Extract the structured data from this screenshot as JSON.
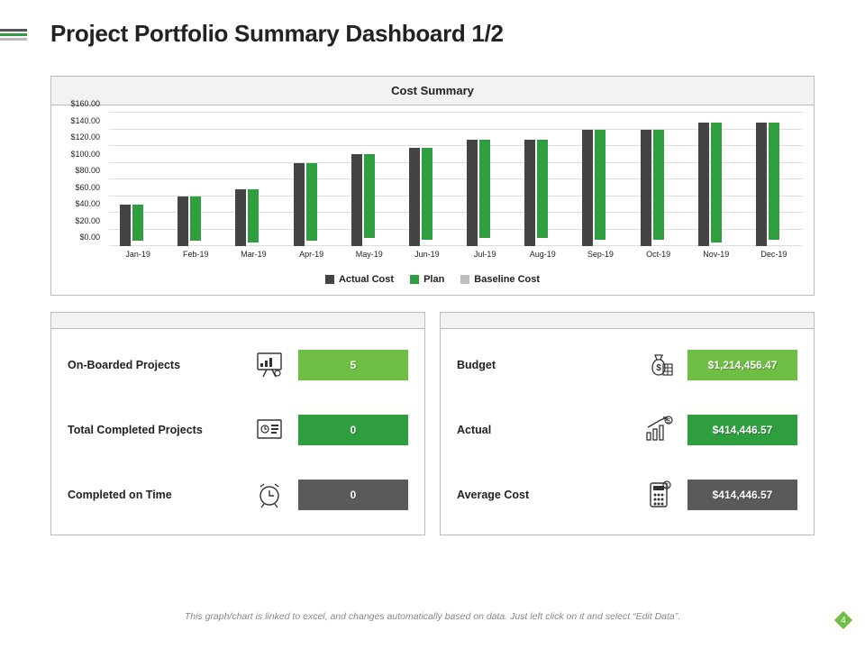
{
  "title": "Project Portfolio Summary Dashboard 1/2",
  "chart_data": {
    "type": "bar",
    "title": "Cost Summary",
    "categories": [
      "Jan-19",
      "Feb-19",
      "Mar-19",
      "Apr-19",
      "May-19",
      "Jun-19",
      "Jul-19",
      "Aug-19",
      "Sep-19",
      "Oct-19",
      "Nov-19",
      "Dec-19"
    ],
    "series": [
      {
        "name": "Actual Cost",
        "color": "#444444",
        "values": [
          50,
          60,
          68,
          100,
          110,
          118,
          128,
          128,
          140,
          140,
          148,
          148
        ]
      },
      {
        "name": "Plan",
        "color": "#2e9e3f",
        "values": [
          44,
          54,
          64,
          94,
          100,
          110,
          118,
          118,
          132,
          132,
          144,
          140
        ]
      },
      {
        "name": "Baseline Cost",
        "color": "#bdbdbd",
        "values": [
          null,
          null,
          null,
          null,
          null,
          null,
          null,
          null,
          null,
          null,
          null,
          null
        ]
      }
    ],
    "ylabel": "",
    "xlabel": "",
    "ylim": [
      0,
      160
    ],
    "y_ticks": [
      "$0.00",
      "$20.00",
      "$40.00",
      "$60.00",
      "$80.00",
      "$100.00",
      "$120.00",
      "$140.00",
      "$160.00"
    ]
  },
  "metrics_left": [
    {
      "label": "On-Boarded Projects",
      "value": "5",
      "pill": "pill-bright",
      "icon": "presentation"
    },
    {
      "label": "Total Completed Projects",
      "value": "0",
      "pill": "pill-green",
      "icon": "board-clock"
    },
    {
      "label": "Completed on Time",
      "value": "0",
      "pill": "pill-gray",
      "icon": "alarm-clock"
    }
  ],
  "metrics_right": [
    {
      "label": "Budget",
      "value": "$1,214,456.47",
      "pill": "pill-bright",
      "icon": "money-bag"
    },
    {
      "label": "Actual",
      "value": "$414,446.57",
      "pill": "pill-green",
      "icon": "bar-growth"
    },
    {
      "label": "Average Cost",
      "value": "$414,446.57",
      "pill": "pill-gray",
      "icon": "calculator"
    }
  ],
  "footer": "This graph/chart is linked to excel, and changes automatically based on data. Just left click on it and select “Edit Data”.",
  "page_number": "4"
}
